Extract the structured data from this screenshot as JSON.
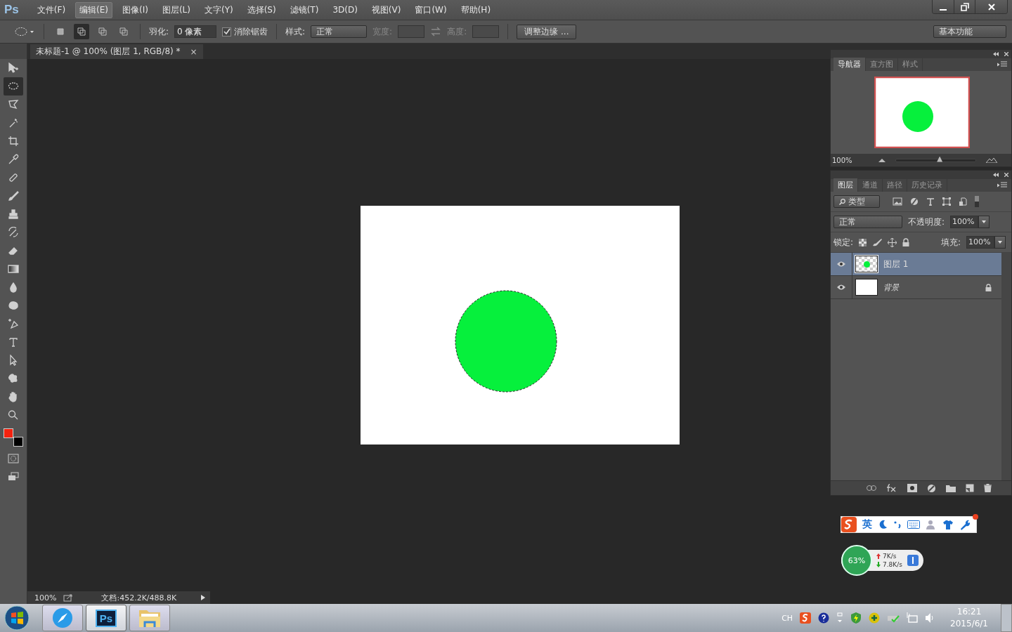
{
  "app": {
    "logo": "Ps"
  },
  "menu": [
    {
      "label": "文件(F)",
      "selected": false
    },
    {
      "label": "编辑(E)",
      "selected": true
    },
    {
      "label": "图像(I)",
      "selected": false
    },
    {
      "label": "图层(L)",
      "selected": false
    },
    {
      "label": "文字(Y)",
      "selected": false
    },
    {
      "label": "选择(S)",
      "selected": false
    },
    {
      "label": "滤镜(T)",
      "selected": false
    },
    {
      "label": "3D(D)",
      "selected": false
    },
    {
      "label": "视图(V)",
      "selected": false
    },
    {
      "label": "窗口(W)",
      "selected": false
    },
    {
      "label": "帮助(H)",
      "selected": false
    }
  ],
  "options_bar": {
    "selection_modes": [
      {
        "kind": "new",
        "selected": false
      },
      {
        "kind": "add",
        "selected": true
      },
      {
        "kind": "subtract",
        "selected": false
      },
      {
        "kind": "intersect",
        "selected": false
      }
    ],
    "feather_label": "羽化:",
    "feather_value": "0 像素",
    "antialias": {
      "label": "消除锯齿",
      "checked": true
    },
    "style_label": "样式:",
    "style_value": "正常",
    "width_label": "宽度:",
    "height_label": "高度:",
    "refine_button": "调整边缘 ...",
    "workspace": "基本功能"
  },
  "tools": [
    {
      "kind": "move",
      "selected": false
    },
    {
      "kind": "ellipse",
      "selected": true
    },
    {
      "kind": "lasso",
      "selected": false
    },
    {
      "kind": "wand",
      "selected": false
    },
    {
      "kind": "crop",
      "selected": false
    },
    {
      "kind": "eyedropper",
      "selected": false
    },
    {
      "kind": "bandage",
      "selected": false
    },
    {
      "kind": "brush",
      "selected": false
    },
    {
      "kind": "stamp",
      "selected": false
    },
    {
      "kind": "history",
      "selected": false
    },
    {
      "kind": "eraser",
      "selected": false
    },
    {
      "kind": "gradient",
      "selected": false
    },
    {
      "kind": "drop",
      "selected": false
    },
    {
      "kind": "sponge",
      "selected": false
    },
    {
      "kind": "pen",
      "selected": false
    },
    {
      "kind": "type",
      "selected": false
    },
    {
      "kind": "arrow",
      "selected": false
    },
    {
      "kind": "shape",
      "selected": false
    },
    {
      "kind": "hand",
      "selected": false
    },
    {
      "kind": "zoom",
      "selected": false
    }
  ],
  "color_swatches": [
    {
      "kind": "foreground",
      "color": "#f3220f"
    },
    {
      "kind": "background",
      "color": "#000000"
    }
  ],
  "document_tab": {
    "title": "未标题-1 @ 100% (图层 1, RGB/8) *",
    "close": "×"
  },
  "canvas": {
    "selection_active": true
  },
  "navigator": {
    "tabs": [
      {
        "label": "导航器",
        "selected": true
      },
      {
        "label": "直方图",
        "selected": false
      },
      {
        "label": "样式",
        "selected": false
      }
    ],
    "zoom": "100%",
    "level": 0.55
  },
  "layers_panel": {
    "tabs": [
      {
        "label": "图层",
        "selected": true
      },
      {
        "label": "通道",
        "selected": false
      },
      {
        "label": "路径",
        "selected": false
      },
      {
        "label": "历史记录",
        "selected": false
      }
    ],
    "filter": "类型",
    "blend_mode": "正常",
    "opacity_label": "不透明度:",
    "opacity": "100%",
    "lock_label": "锁定:",
    "fill_label": "填充:",
    "fill": "100%",
    "layers": [
      {
        "name": "图层 1",
        "kind": "circle",
        "selected": true,
        "visible": true,
        "locked": false
      },
      {
        "name": "背景",
        "kind": "background",
        "selected": false,
        "visible": true,
        "locked": true
      }
    ]
  },
  "status_bar": {
    "zoom": "100%",
    "doc_info": "文档:452.2K/488.8K"
  },
  "ime_bar": {
    "mode": "英"
  },
  "net_widget": {
    "percent": "63%",
    "up": "7K/s",
    "down": "7.8K/s"
  },
  "taskbar": {
    "apps": [
      {
        "kind": "browser",
        "selected": false
      },
      {
        "kind": "photoshop",
        "label": "Ps",
        "selected": true
      },
      {
        "kind": "folder",
        "selected": false
      }
    ],
    "lang": "CH",
    "time": "16:21",
    "date": "2015/6/1"
  }
}
